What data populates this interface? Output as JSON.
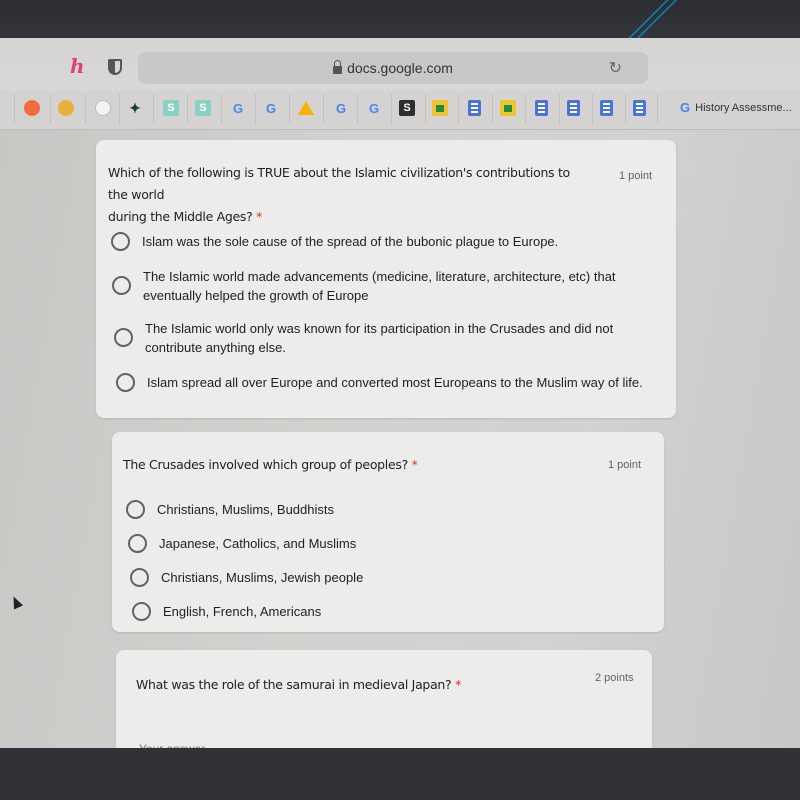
{
  "browser": {
    "url": "docs.google.com",
    "extensions": [
      "honey-extension-icon",
      "privacy-shield-icon"
    ],
    "bookmarks": [
      {
        "icon": "crunchyroll-icon"
      },
      {
        "icon": "emoji-face-icon"
      },
      {
        "icon": "cartoon-bot-icon"
      },
      {
        "icon": "green-creature-icon"
      },
      {
        "icon": "s-teal-icon",
        "glyph": "S"
      },
      {
        "icon": "s-teal-icon",
        "glyph": "S"
      },
      {
        "icon": "google-icon",
        "glyph": "G"
      },
      {
        "icon": "google-icon",
        "glyph": "G"
      },
      {
        "icon": "google-drive-icon"
      },
      {
        "icon": "google-icon",
        "glyph": "G"
      },
      {
        "icon": "google-icon",
        "glyph": "G"
      },
      {
        "icon": "s-dark-icon",
        "glyph": "S"
      },
      {
        "icon": "google-classroom-icon"
      },
      {
        "icon": "google-docs-icon"
      },
      {
        "icon": "google-classroom-icon"
      },
      {
        "icon": "google-docs-icon"
      },
      {
        "icon": "google-docs-icon"
      },
      {
        "icon": "google-docs-icon"
      },
      {
        "icon": "google-docs-icon"
      }
    ],
    "bookmark_label": "History Assessme...",
    "bookmark_label_glyph": "G"
  },
  "form": {
    "required_marker": "*",
    "questions": [
      {
        "title_line1": "Which of the following is TRUE about the Islamic civilization's contributions to the world",
        "title_line2": "during the Middle Ages?",
        "points": "1 point",
        "options": [
          {
            "line1": "Islam was the sole cause of the spread of the bubonic plague to Europe.",
            "line2": ""
          },
          {
            "line1": "The Islamic world made advancements (medicine, literature, architecture, etc) that",
            "line2": "eventually helped the growth of Europe"
          },
          {
            "line1": "The Islamic world only was known for its participation in the Crusades and did not",
            "line2": "contribute anything else."
          },
          {
            "line1": "Islam spread all over Europe and converted most Europeans to the Muslim way of life.",
            "line2": ""
          }
        ]
      },
      {
        "title_line1": "The Crusades involved which group of peoples?",
        "points": "1 point",
        "options": [
          {
            "line1": "Christians, Muslims, Buddhists"
          },
          {
            "line1": "Japanese, Catholics, and Muslims"
          },
          {
            "line1": "Christians, Muslims, Jewish people"
          },
          {
            "line1": "English, French, Americans"
          }
        ]
      },
      {
        "title_line1": "What was the role of the samurai in medieval Japan?",
        "points": "2 points",
        "answer_placeholder": "Your answer",
        "answer_value": ""
      }
    ]
  }
}
